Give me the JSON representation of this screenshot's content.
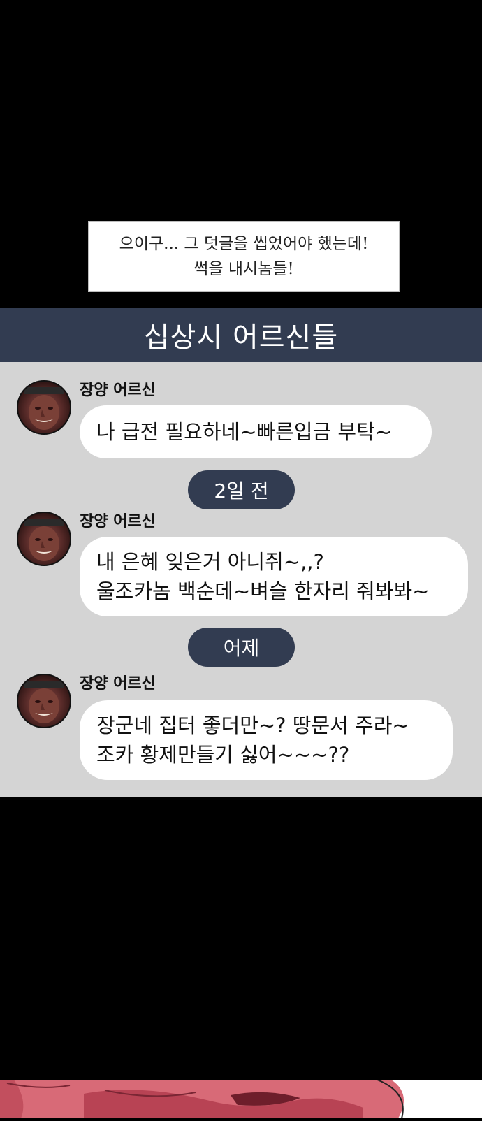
{
  "narration": {
    "lines": [
      "으이구... 그 덧글을 씹었어야 했는데!",
      "썩을 내시놈들!"
    ]
  },
  "chat": {
    "title": "십상시 어르신들",
    "messages": [
      {
        "sender": "장양 어르신",
        "lines": [
          "나 급전 필요하네~빠른입금 부탁~"
        ]
      },
      {
        "sender": "장양 어르신",
        "lines": [
          "내 은혜 잊은거 아니쥐~,,?",
          "울조카놈 백순데~벼슬 한자리 줘봐봐~"
        ]
      },
      {
        "sender": "장양 어르신",
        "lines": [
          "장군네 집터 좋더만~? 땅문서 주라~",
          "조카 황제만들기 싫어~~~??"
        ]
      }
    ],
    "dates": [
      "2일 전",
      "어제"
    ]
  },
  "colors": {
    "background": "#000000",
    "panel": "#d4d4d4",
    "header": "#323c51",
    "bubble": "#ffffff"
  }
}
